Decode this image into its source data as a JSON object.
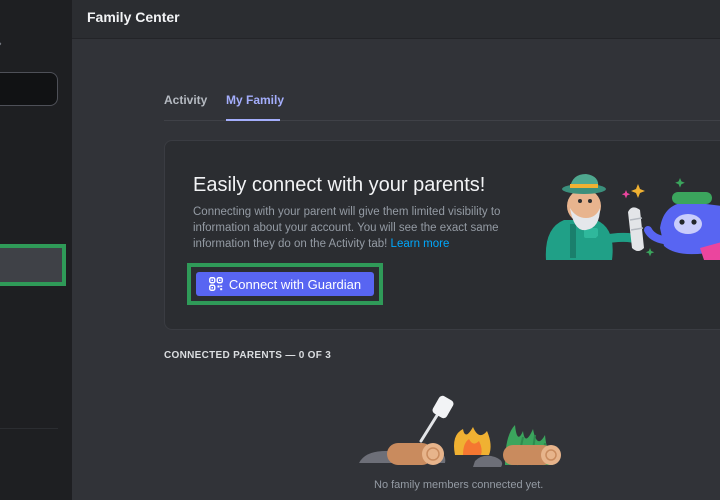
{
  "header": {
    "title": "Family Center"
  },
  "tabs": [
    {
      "label": "Activity",
      "active": false
    },
    {
      "label": "My Family",
      "active": true
    }
  ],
  "connect_card": {
    "headline": "Easily connect with your parents!",
    "description": "Connecting with your parent will give them limited visibility to information about your account. You will see the exact same information they do on the Activity tab!",
    "link_label": "Learn more",
    "button_label": "Connect with Guardian",
    "button_icon": "qr-code-icon"
  },
  "connected_parents": {
    "label": "CONNECTED PARENTS — 0 OF 3",
    "empty_text": "No family members connected yet."
  },
  "colors": {
    "accent": "#5865f2",
    "active_tab": "#a4aefc",
    "link": "#00a8fc",
    "highlight_frame": "#2f9a58"
  }
}
